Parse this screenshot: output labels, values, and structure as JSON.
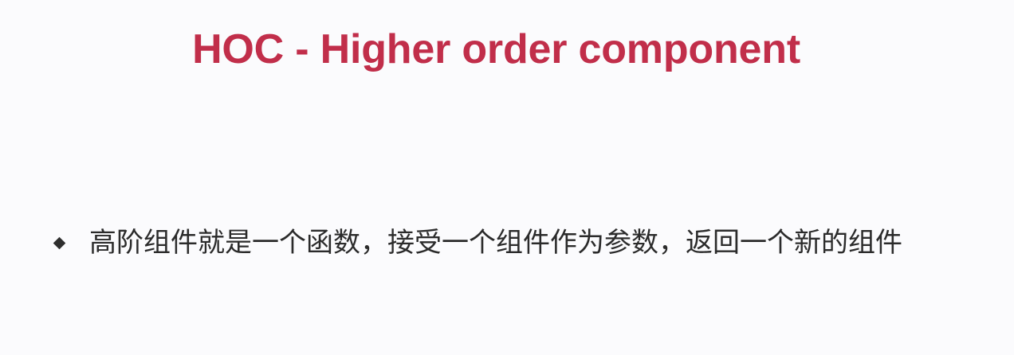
{
  "slide": {
    "title": "HOC - Higher order component",
    "bullets": [
      "高阶组件就是一个函数，接受一个组件作为参数，返回一个新的组件"
    ],
    "colors": {
      "title": "#c12e4a",
      "text": "#2b2b2b",
      "background": "#fbfbfd"
    }
  }
}
